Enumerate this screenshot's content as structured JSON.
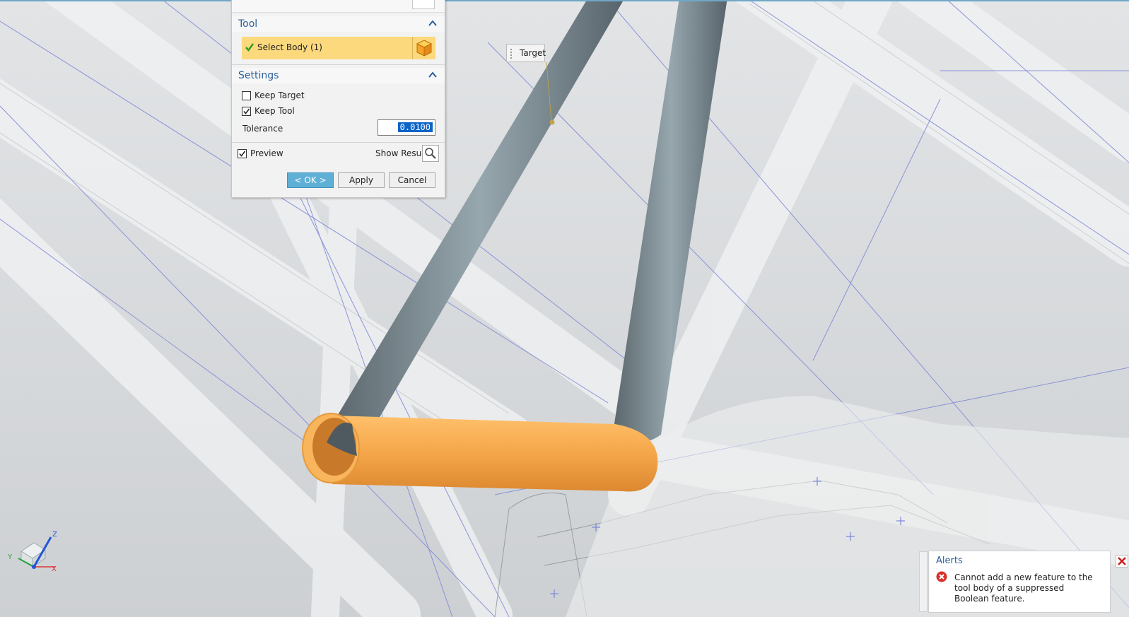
{
  "dialog": {
    "tool_section": "Tool",
    "select_body": "Select Body (1)",
    "settings_section": "Settings",
    "keep_target": {
      "label": "Keep Target",
      "checked": false
    },
    "keep_tool": {
      "label": "Keep Tool",
      "checked": true
    },
    "tolerance_label": "Tolerance",
    "tolerance_value": "0.0100",
    "preview": {
      "label": "Preview",
      "checked": true
    },
    "show_result_label": "Show Result",
    "ok_label": "< OK >",
    "apply_label": "Apply",
    "cancel_label": "Cancel"
  },
  "viewport": {
    "target_label": "Target",
    "triad": {
      "x": "X",
      "y": "Y",
      "z": "Z"
    }
  },
  "alerts": {
    "title": "Alerts",
    "message": "Cannot add a new feature to the tool body of a suppressed Boolean feature."
  },
  "colors": {
    "accent": "#2a5f9e",
    "selection": "#fbd97c",
    "ok_button": "#5fb0d6",
    "tool_body": "#f5a64a",
    "target_tubes": "#6f7d83",
    "error": "#d9302a"
  }
}
